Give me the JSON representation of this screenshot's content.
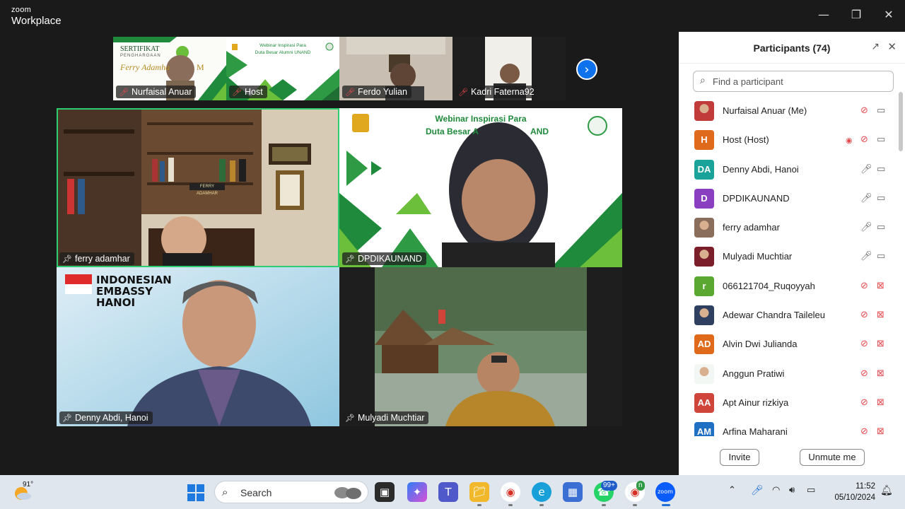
{
  "app": {
    "brand_top": "zoom",
    "brand_bottom": "Workplace"
  },
  "window_controls": {
    "minimize": "—",
    "restore": "❐",
    "close": "✕"
  },
  "gallery_strip": {
    "thumbnails": [
      {
        "name": "Nurfaisal Anuar",
        "mic": "muted",
        "certificate": {
          "title": "SERTIFIKAT",
          "subtitle": "PENGHARGAAN",
          "name": "Ferry Adamha",
          "suffix": "M"
        }
      },
      {
        "name": "Host",
        "mic": "muted",
        "banner": [
          "Webinar Inspirasi Para",
          "Duta Besar Alumni UNAND"
        ]
      },
      {
        "name": "Ferdo Yulian",
        "mic": "muted"
      },
      {
        "name": "Kadri Faterna92",
        "mic": "muted"
      }
    ],
    "next_icon": "›"
  },
  "video_tiles": [
    {
      "name": "ferry adamhar",
      "active": true,
      "nameplate": "FERRY ADAMHAR"
    },
    {
      "name": "DPDIKAUNAND",
      "banner_line1": "Webinar Inspirasi Para",
      "banner_line2": "Duta Besar A",
      "banner_line2_end": "AND"
    },
    {
      "name": "Denny Abdi, Hanoi",
      "embassy_text": [
        "INDONESIAN",
        "EMBASSY",
        "HANOI"
      ]
    },
    {
      "name": "Mulyadi Muchtiar"
    }
  ],
  "participants": {
    "title": "Participants (74)",
    "search_placeholder": "Find a participant",
    "list": [
      {
        "initials": "",
        "avatar_color": "#c23b3b",
        "photo": true,
        "name": "Nurfaisal Anuar (Me)",
        "mic": "muted",
        "cam": "on"
      },
      {
        "initials": "H",
        "avatar_color": "#e06a1b",
        "name": "Host (Host)",
        "mic": "muted",
        "cam": "on",
        "recording": true
      },
      {
        "initials": "DA",
        "avatar_color": "#1aa39a",
        "name": "Denny Abdi, Hanoi",
        "mic": "on",
        "cam": "on"
      },
      {
        "initials": "D",
        "avatar_color": "#8a3fc1",
        "name": "DPDIKAUNAND",
        "mic": "on",
        "cam": "on"
      },
      {
        "initials": "",
        "avatar_color": "#8a6d5a",
        "photo": true,
        "name": "ferry adamhar",
        "mic": "on",
        "cam": "on"
      },
      {
        "initials": "",
        "avatar_color": "#7a1f2a",
        "photo": true,
        "name": "Mulyadi Muchtiar",
        "mic": "on",
        "cam": "on"
      },
      {
        "initials": "r",
        "avatar_color": "#5aa832",
        "name": "066121704_Ruqoyyah",
        "mic": "muted",
        "cam": "off"
      },
      {
        "initials": "",
        "avatar_color": "#2e3f60",
        "photo": true,
        "name": "Adewar Chandra Taileleu",
        "mic": "muted",
        "cam": "off"
      },
      {
        "initials": "AD",
        "avatar_color": "#e06a1b",
        "name": "Alvin Dwi Julianda",
        "mic": "muted",
        "cam": "off"
      },
      {
        "initials": "",
        "avatar_color": "#f3f7f3",
        "photo": true,
        "name": "Anggun Pratiwi",
        "mic": "muted",
        "cam": "off"
      },
      {
        "initials": "AA",
        "avatar_color": "#d0453a",
        "name": "Apt Ainur rizkiya",
        "mic": "muted",
        "cam": "off"
      },
      {
        "initials": "AM",
        "avatar_color": "#1f6fc2",
        "name": "Arfina Maharani",
        "mic": "muted",
        "cam": "off"
      }
    ],
    "invite_label": "Invite",
    "unmute_label": "Unmute me"
  },
  "taskbar": {
    "weather_temp": "91°",
    "search_label": "Search",
    "whatsapp_badge": "99+",
    "chrome_badge": "n",
    "time": "11:52",
    "date": "05/10/2024"
  }
}
